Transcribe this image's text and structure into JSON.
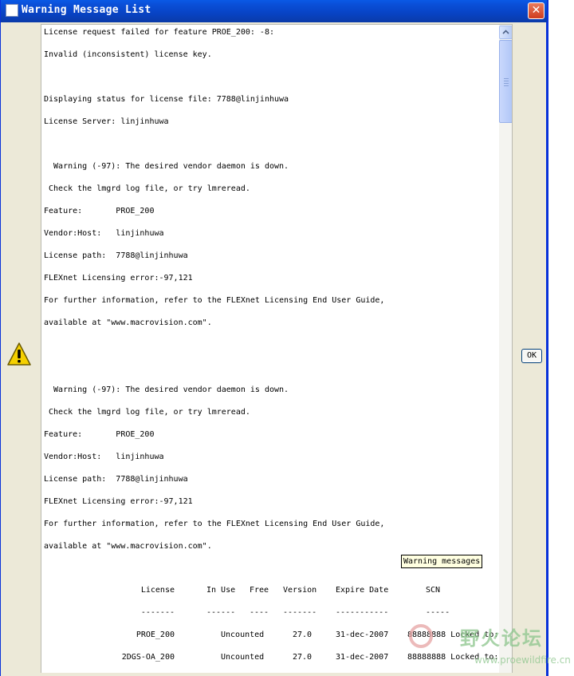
{
  "window": {
    "title": "Warning Message List",
    "close_glyph": "✕",
    "ok_label": "OK"
  },
  "messages": [
    "License request failed for feature PROE_200: -8:",
    "Invalid (inconsistent) license key.",
    "",
    "Displaying status for license file: 7788@linjinhuwa",
    "License Server: linjinhuwa",
    "",
    "  Warning (-97): The desired vendor daemon is down.",
    " Check the lmgrd log file, or try lmreread.",
    "Feature:       PROE_200",
    "Vendor:Host:   linjinhuwa",
    "License path:  7788@linjinhuwa",
    "FLEXnet Licensing error:-97,121",
    "For further information, refer to the FLEXnet Licensing End User Guide,",
    "available at \"www.macrovision.com\".",
    "",
    "",
    "  Warning (-97): The desired vendor daemon is down.",
    " Check the lmgrd log file, or try lmreread.",
    "Feature:       PROE_200",
    "Vendor:Host:   linjinhuwa",
    "License path:  7788@linjinhuwa",
    "FLEXnet Licensing error:-97,121",
    "For further information, refer to the FLEXnet Licensing End User Guide,",
    "available at \"www.macrovision.com\"."
  ],
  "tooltip": "Warning messages",
  "license_table": {
    "headers": {
      "license": "License",
      "in_use": "In Use",
      "free": "Free",
      "version": "Version",
      "expire": "Expire Date",
      "scn": "SCN"
    },
    "rules": {
      "license": "-------",
      "in_use": "------",
      "free": "----",
      "version": "-------",
      "expire": "-----------",
      "scn": "-----"
    },
    "rows": [
      {
        "license": "PROE_200",
        "in_use": "Uncounted",
        "free": "",
        "version": "27.0",
        "expire": "31-dec-2007",
        "scn": "88888888 Locked to:"
      },
      {
        "license": "2DGS-OA_200",
        "in_use": "Uncounted",
        "free": "",
        "version": "27.0",
        "expire": "31-dec-2007",
        "scn": "88888888 Locked to:"
      }
    ]
  },
  "watermark": {
    "text": "野火论坛",
    "url": "www.proewildfire.cn"
  },
  "icons": {
    "warning": "warning-triangle-icon",
    "scroll_up": "arrow-up-icon",
    "window": "window-icon"
  },
  "colors": {
    "titlebar": "#0a4fd8",
    "close": "#d9502e",
    "warning_yellow": "#f5d000",
    "background": "#ece9d8"
  }
}
